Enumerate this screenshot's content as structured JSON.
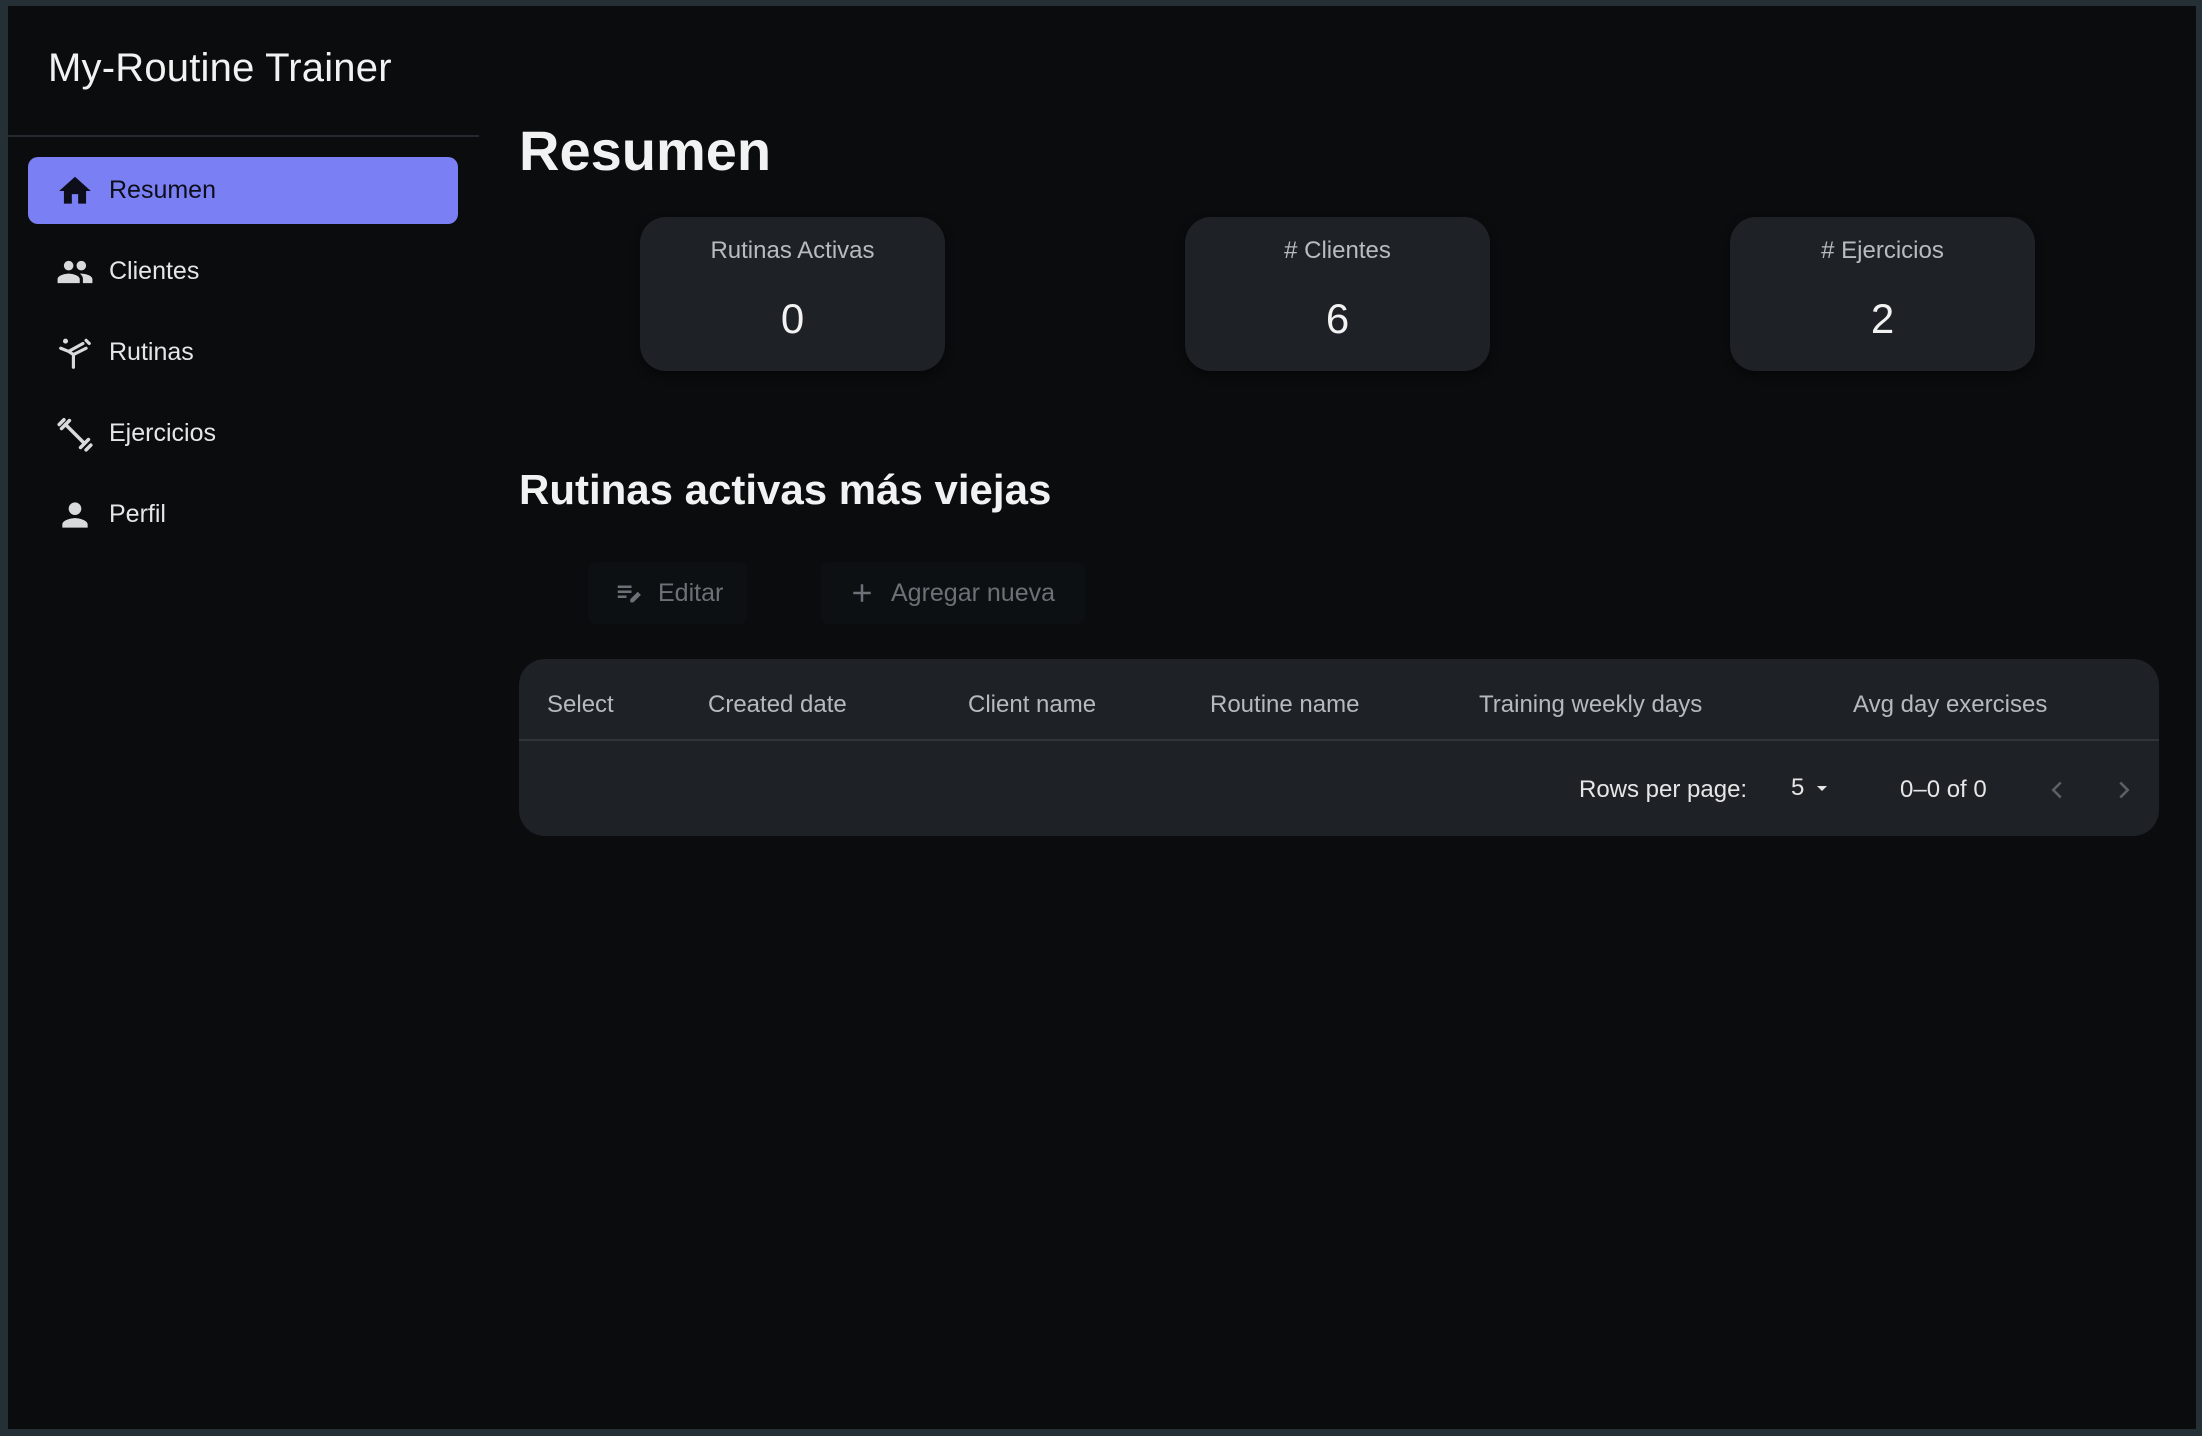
{
  "app": {
    "title": "My-Routine Trainer"
  },
  "sidebar": {
    "items": [
      {
        "label": "Resumen",
        "icon": "home-icon",
        "active": true
      },
      {
        "label": "Clientes",
        "icon": "people-icon",
        "active": false
      },
      {
        "label": "Rutinas",
        "icon": "kick-figure-icon",
        "active": false
      },
      {
        "label": "Ejercicios",
        "icon": "dumbbell-icon",
        "active": false
      },
      {
        "label": "Perfil",
        "icon": "person-icon",
        "active": false
      }
    ]
  },
  "main": {
    "title": "Resumen",
    "stats": [
      {
        "label": "Rutinas Activas",
        "value": "0"
      },
      {
        "label": "# Clientes",
        "value": "6"
      },
      {
        "label": "# Ejercicios",
        "value": "2"
      }
    ],
    "section_title": "Rutinas activas más viejas",
    "toolbar": {
      "edit_label": "Editar",
      "add_label": "Agregar nueva"
    },
    "table": {
      "columns": [
        "Select",
        "Created date",
        "Client name",
        "Routine name",
        "Training weekly days",
        "Avg day exercises"
      ],
      "rows": [],
      "rows_per_page_label": "Rows per page:",
      "rows_per_page_value": "5",
      "range_label": "0–0 of 0"
    }
  },
  "colors": {
    "accent": "#7b7ff4",
    "background": "#0a0c0e",
    "card": "#1e2226"
  }
}
